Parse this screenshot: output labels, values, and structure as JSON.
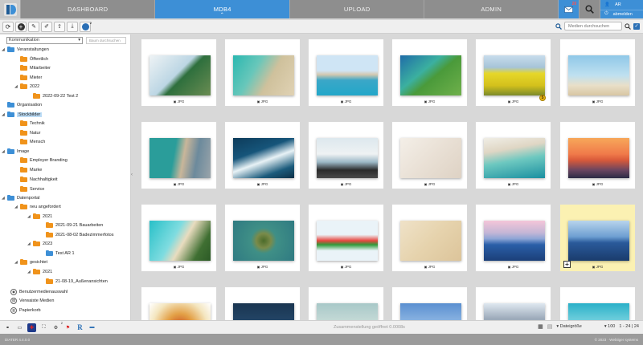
{
  "nav": {
    "tabs": [
      {
        "label": "DASHBOARD"
      },
      {
        "label": "MDB4"
      },
      {
        "label": "UPLOAD"
      },
      {
        "label": "ADMIN"
      }
    ],
    "mail_count": "20",
    "user_initials": "AR",
    "logout_label": "abmelden"
  },
  "toolbar": {
    "buttons": [
      "refresh-icon",
      "add-icon",
      "edit-icon",
      "copy-edit-icon",
      "upload-icon",
      "download-icon",
      "user-icon"
    ],
    "user_badge": "2",
    "search_placeholder": "Medien durchsuchen"
  },
  "sidebar": {
    "category": "Kommunikation",
    "tree_search_placeholder": "Baum durchsuchen",
    "items": [
      {
        "label": "Veranstaltungen"
      },
      {
        "label": "Öffentlich"
      },
      {
        "label": "Mitarbeiter"
      },
      {
        "label": "Mieter"
      },
      {
        "label": "2022"
      },
      {
        "label": "2022-09-22 Test 2"
      },
      {
        "label": "Organisation"
      },
      {
        "label": "Stockbilder"
      },
      {
        "label": "Technik"
      },
      {
        "label": "Natur"
      },
      {
        "label": "Mensch"
      },
      {
        "label": "Image"
      },
      {
        "label": "Employer Branding"
      },
      {
        "label": "Marke"
      },
      {
        "label": "Nachhaltigkeit"
      },
      {
        "label": "Service"
      },
      {
        "label": "Datenportal"
      },
      {
        "label": "neu angefordert"
      },
      {
        "label": "2021"
      },
      {
        "label": "2021-09-21 Bauarbeiten"
      },
      {
        "label": "2021-08-02 Badezimmerfotos"
      },
      {
        "label": "2023"
      },
      {
        "label": "Test AR 1"
      },
      {
        "label": "gesichtet"
      },
      {
        "label": "2021"
      },
      {
        "label": "21-08-19_Außenansichten"
      },
      {
        "label": "Benutzermedienauswahl"
      },
      {
        "label": "Verwaiste Medien"
      },
      {
        "label": "Papierkorb"
      }
    ]
  },
  "media": [
    {
      "format": "JPG",
      "image": "palm tree against sky"
    },
    {
      "format": "JPG",
      "image": "aerial beach and turquoise sea"
    },
    {
      "format": "JPG",
      "image": "coastal old town"
    },
    {
      "format": "JPG",
      "image": "aerial green coastline"
    },
    {
      "format": "JPG",
      "image": "yellow rapeseed field"
    },
    {
      "format": "JPG",
      "image": "palm trees on beach"
    },
    {
      "format": "JPG",
      "image": "aerial beach with boardwalk"
    },
    {
      "format": "JPG",
      "image": "surfer on wave"
    },
    {
      "format": "JPG",
      "image": "people cheering at sea"
    },
    {
      "format": "JPG",
      "image": "footprints in sand"
    },
    {
      "format": "JPG",
      "image": "wave on beach"
    },
    {
      "format": "JPG",
      "image": "paddleboarder at sunset"
    },
    {
      "format": "JPG",
      "image": "tropical beach aerial"
    },
    {
      "format": "JPG",
      "image": "island in turquoise sea"
    },
    {
      "format": "JPG",
      "image": "watermelon slice"
    },
    {
      "format": "JPG",
      "image": "beach with footprints"
    },
    {
      "format": "JPG",
      "image": "sea under pastel sky"
    },
    {
      "format": "JPG",
      "image": "ocean horizon"
    },
    {
      "format": "",
      "image": "pizza"
    },
    {
      "format": "",
      "image": "dark sea"
    },
    {
      "format": "",
      "image": "misty water"
    },
    {
      "format": "",
      "image": "blue sky"
    },
    {
      "format": "",
      "image": "snowy mountains"
    },
    {
      "format": "",
      "image": "water surface"
    }
  ],
  "bottom": {
    "status": "Zusammenstellung geöffnet 0.0008s",
    "sort_label": "Dateigröße",
    "page_size": "100",
    "range": "1 - 24 | 24",
    "language_badge": "2"
  },
  "footer": {
    "version": "DIATER 4.4.0.0",
    "copyright": "© 2023 · Webtiger systems"
  }
}
